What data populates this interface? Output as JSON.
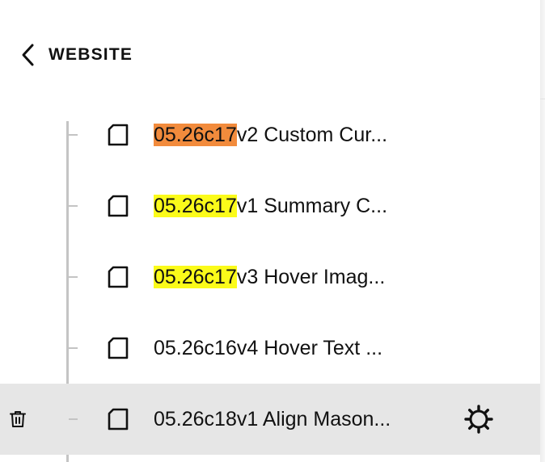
{
  "header": {
    "back_icon": "chevron-left-icon",
    "title": "WEBSITE"
  },
  "pages": [
    {
      "highlight": "05.26c17",
      "highlight_color": "#f28b3c",
      "rest": "v2 Custom Cur...",
      "selected": false,
      "icon": "page-icon"
    },
    {
      "highlight": "05.26c17",
      "highlight_color": "#fbfb1a",
      "rest": "v1 Summary C...",
      "selected": false,
      "icon": "page-icon"
    },
    {
      "highlight": "05.26c17",
      "highlight_color": "#fbfb1a",
      "rest": "v3 Hover Imag...",
      "selected": false,
      "icon": "page-icon"
    },
    {
      "highlight": "",
      "highlight_color": "",
      "rest": "05.26c16v4 Hover Text ...",
      "selected": false,
      "icon": "page-icon"
    },
    {
      "highlight": "",
      "highlight_color": "",
      "rest": "05.26c18v1 Align Mason...",
      "selected": true,
      "icon": "page-icon",
      "row_actions": [
        "trash-icon",
        "gear-icon"
      ]
    }
  ],
  "colors": {
    "selected_row_bg": "#e6e6e6",
    "tree_line": "#c4c4c4",
    "highlight_orange": "#f28b3c",
    "highlight_yellow": "#fbfb1a"
  }
}
